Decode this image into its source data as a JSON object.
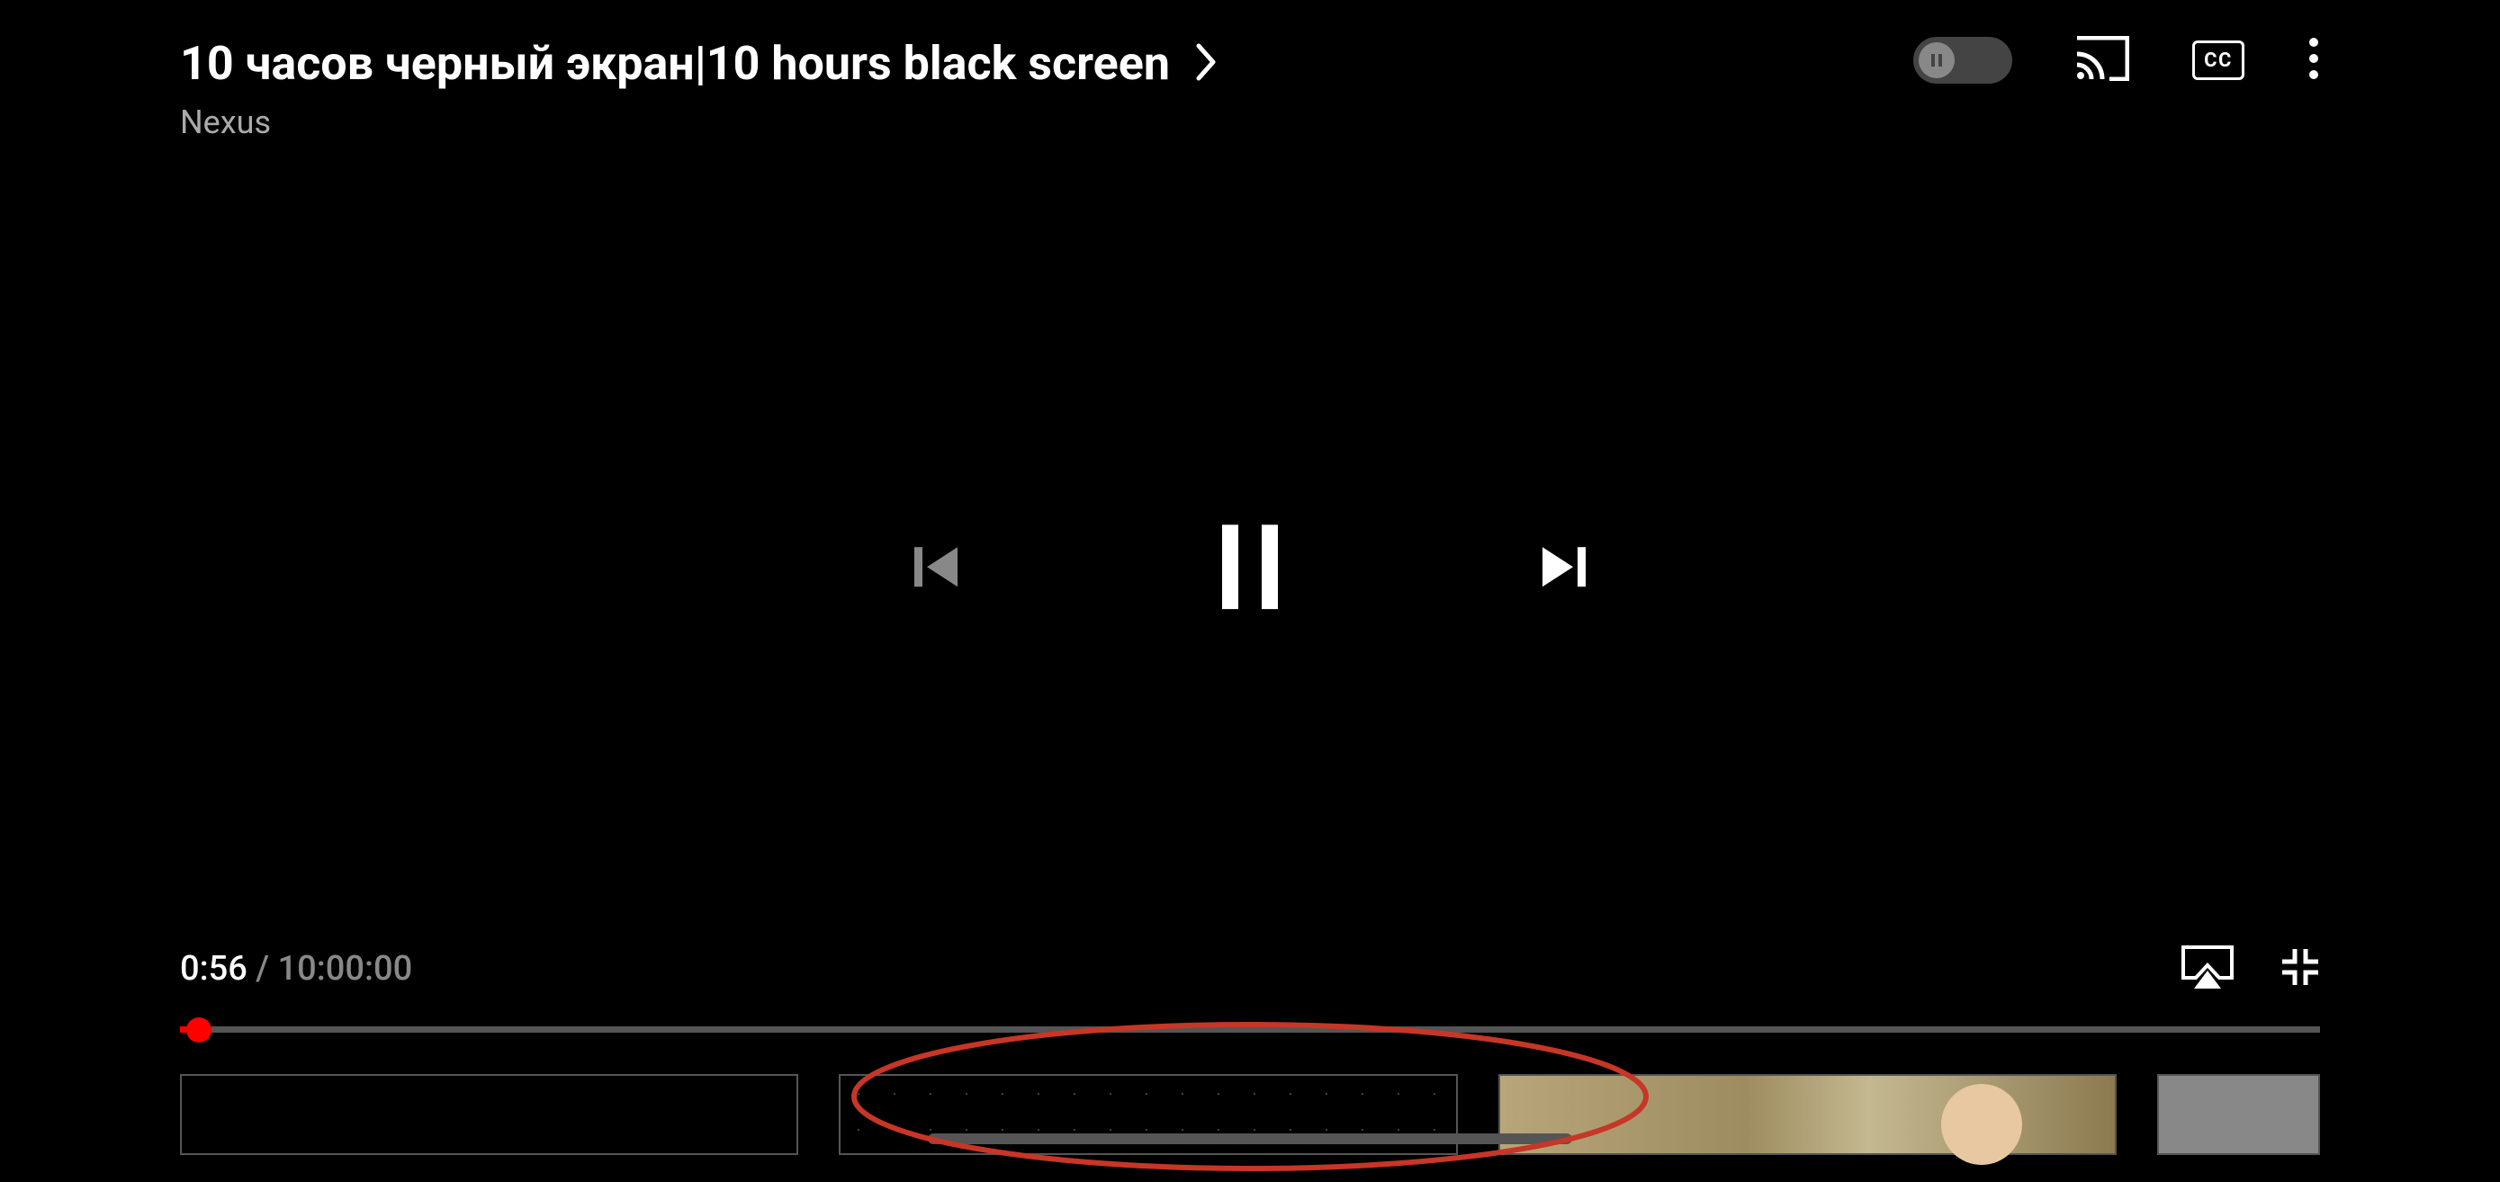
{
  "video": {
    "title": "10 часов черный экран|10 hours black screen",
    "channel": "Nexus"
  },
  "playback": {
    "current_time": "0:56",
    "total_time": "10:00:00",
    "progress_percent": 0.9
  },
  "header": {
    "cc_label": "CC"
  },
  "colors": {
    "accent": "#ff0000",
    "annotation": "#c73626"
  }
}
